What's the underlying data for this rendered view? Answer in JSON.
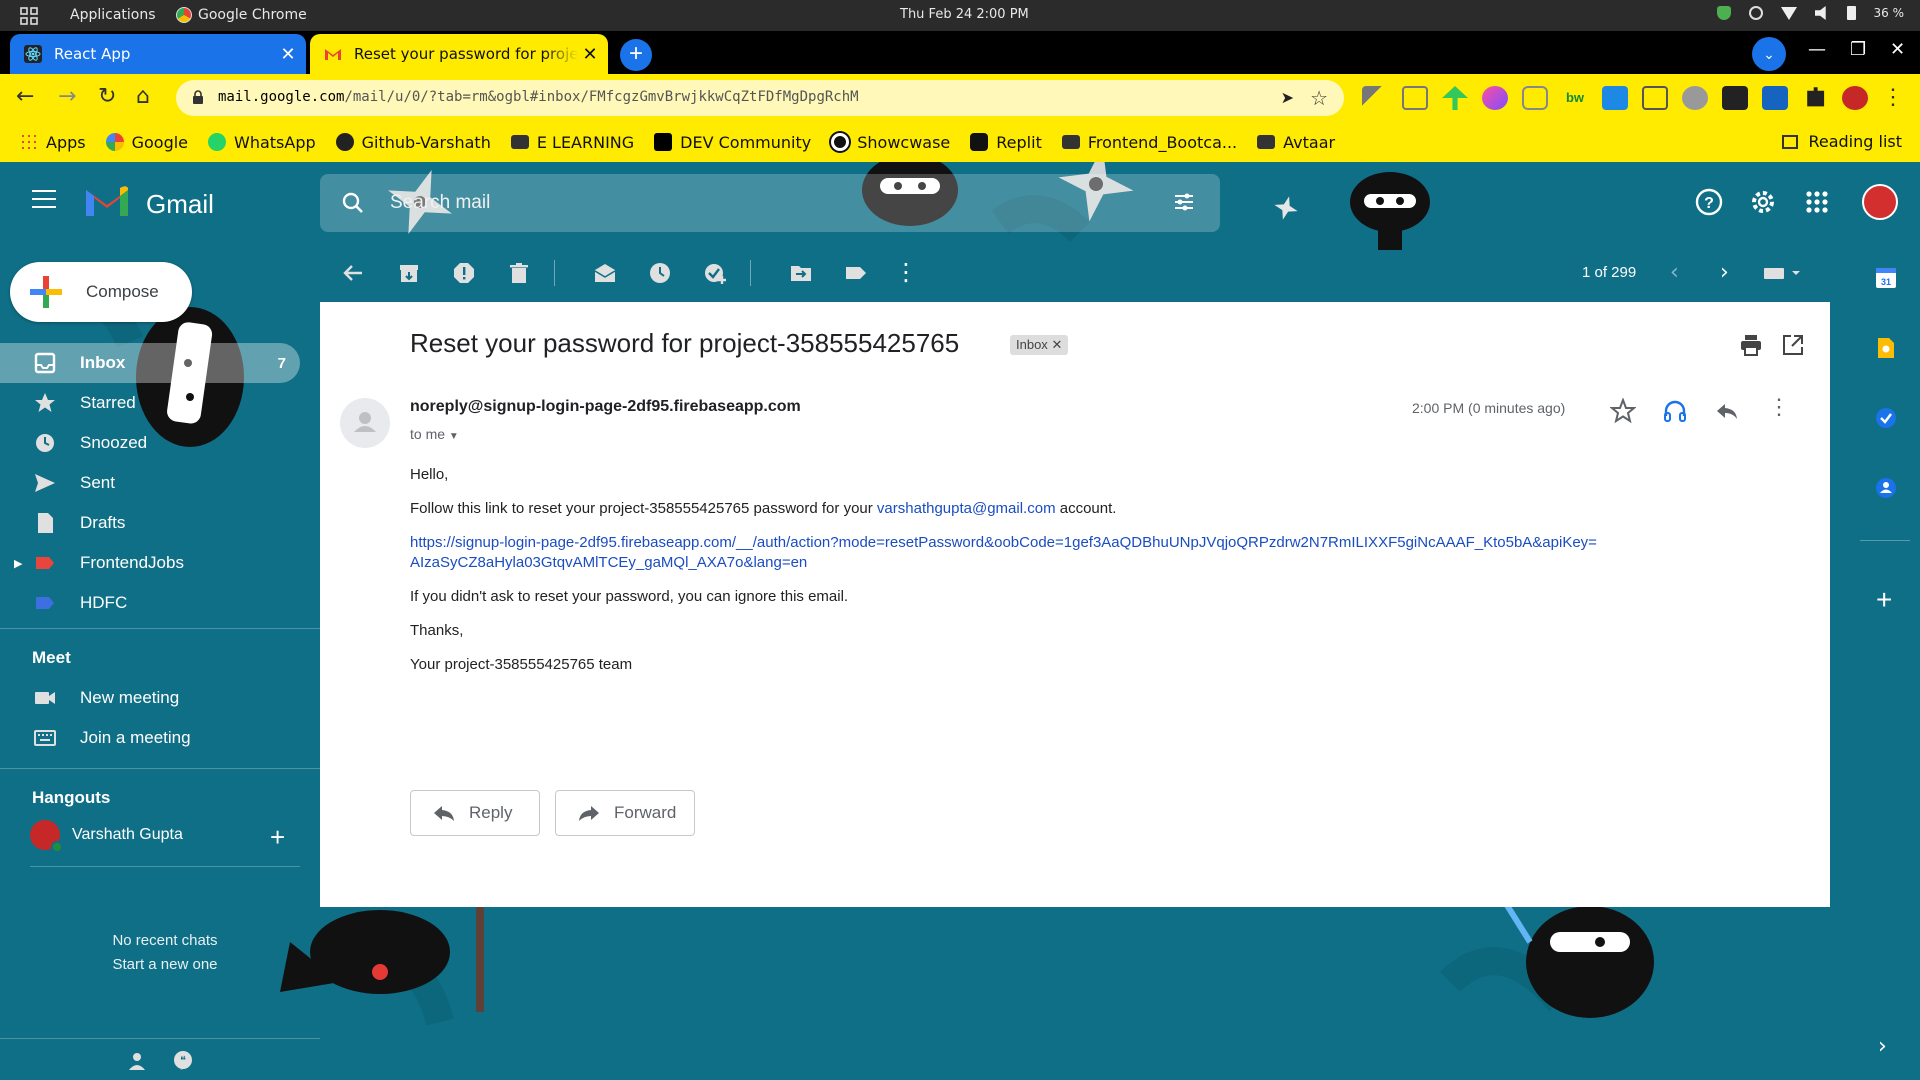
{
  "os": {
    "apps_label": "Applications",
    "browser_label": "Google Chrome",
    "clock": "Thu Feb 24   2:00 PM",
    "battery": "36 %"
  },
  "tabs": [
    {
      "title": "React App"
    },
    {
      "title": "Reset your password for project"
    }
  ],
  "address": {
    "domain": "mail.google.com",
    "path": "/mail/u/0/?tab=rm&ogbl#inbox/FMfcgzGmvBrwjkkwCqZtFDfMgDpgRchM"
  },
  "bookmarks": [
    "Apps",
    "Google",
    "WhatsApp",
    "Github-Varshath",
    "E LEARNING",
    "DEV Community",
    "Showcwase",
    "Replit",
    "Frontend_Bootca...",
    "Avtaar"
  ],
  "reading_list": "Reading list",
  "gmail": {
    "brand": "Gmail",
    "search_placeholder": "Search mail",
    "compose": "Compose"
  },
  "nav": [
    {
      "label": "Inbox",
      "count": "7"
    },
    {
      "label": "Starred"
    },
    {
      "label": "Snoozed"
    },
    {
      "label": "Sent"
    },
    {
      "label": "Drafts"
    },
    {
      "label": "FrontendJobs"
    },
    {
      "label": "HDFC"
    }
  ],
  "meet": {
    "title": "Meet",
    "new_meeting": "New meeting",
    "join": "Join a meeting"
  },
  "hangouts": {
    "title": "Hangouts",
    "user": "Varshath Gupta",
    "no_recent": "No recent chats",
    "start_new": "Start a new one"
  },
  "pager": "1 of 299",
  "message": {
    "subject": "Reset your password for project-358555425765",
    "label_chip": "Inbox",
    "sender": "noreply@signup-login-page-2df95.firebaseapp.com",
    "to": "to me",
    "time": "2:00 PM (0 minutes ago)",
    "greeting": "Hello,",
    "line1_pre": "Follow this link to reset your project-358555425765 password for your ",
    "line1_email": "varshathgupta@gmail.com",
    "line1_post": " account.",
    "reset_link_1": "https://signup-login-page-2df95.firebaseapp.com/__/auth/action?mode=resetPassword&oobCode=1gef3AaQDBhuUNpJVqjoQRPzdrw2N7RmILIXXF5giNcAAAF_Kto5bA&apiKey=",
    "reset_link_2": "AIzaSyCZ8aHyla03GtqvAMlTCEy_gaMQl_AXA7o&lang=en",
    "ignore_line": "If you didn't ask to reset your password, you can ignore this email.",
    "thanks": "Thanks,",
    "signature": "Your project-358555425765 team",
    "reply": "Reply",
    "forward": "Forward"
  },
  "colors": {
    "theme_teal": "#0f6f86",
    "chrome_yellow": "#ffeb00",
    "link_blue": "#1a4dc2"
  }
}
